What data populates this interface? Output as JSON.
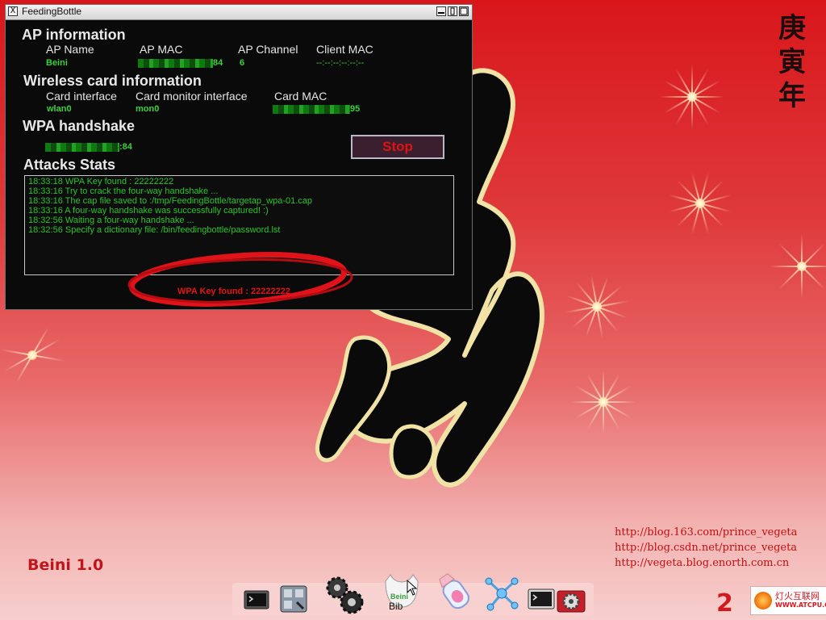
{
  "window": {
    "title": "FeedingBottle",
    "close_glyph": "X"
  },
  "ap_info": {
    "heading": "AP information",
    "columns": [
      "AP Name",
      "AP MAC",
      "AP Channel",
      "Client MAC"
    ],
    "ap_name": "Beini",
    "ap_mac_suffix": "84",
    "ap_channel": "6",
    "client_mac": "--:--:--:--:--:--"
  },
  "wireless_card": {
    "heading": "Wireless card information",
    "columns": [
      "Card interface",
      "Card monitor interface",
      "Card MAC"
    ],
    "card_interface": "wlan0",
    "monitor_interface": "mon0",
    "card_mac_suffix": "95"
  },
  "wpa_handshake": {
    "heading": "WPA handshake",
    "mac_suffix": ":84"
  },
  "stop_button": {
    "label": "Stop"
  },
  "attacks_stats": {
    "heading": "Attacks Stats",
    "lines": [
      "18:33:18 WPA Key found : 22222222",
      "18:33:16 Try to crack the four-way handshake ...",
      "18:33:16 The cap file saved to :/tmp/FeedingBottle/targetap_wpa-01.cap",
      "18:33:16 A four-way handshake was successfully captured! :)",
      "18:32:56 Waiting a four-way handshake ...",
      "18:32:56 Specify a dictionary file: /bin/feedingbottle/password.lst"
    ]
  },
  "status": {
    "wpa_key_found": "WPA Key found : 22222222"
  },
  "desktop": {
    "version_label": "Beini 1.0",
    "calligraphy": [
      "庚",
      "寅",
      "年"
    ],
    "blog_links": [
      "http://blog.163.com/prince_vegeta",
      "http://blog.csdn.net/prince_vegeta",
      "http://vegeta.blog.enorth.com.cn"
    ],
    "corner_logo": {
      "mark": "2",
      "name": "灯火互联网",
      "url": "WWW.ATCPU.COM"
    },
    "colors": {
      "background_top": "#d8161a",
      "background_bottom": "#f7cfcd",
      "accent_red": "#c0151b"
    }
  },
  "dock": {
    "items": [
      {
        "icon": "terminal-icon"
      },
      {
        "icon": "file-manager-icon"
      },
      {
        "icon": "gears-icon"
      },
      {
        "icon": "bib-icon",
        "label": "Bib"
      },
      {
        "icon": "feeding-bottle-icon"
      },
      {
        "icon": "network-icon"
      },
      {
        "icon": "console-icon"
      },
      {
        "icon": "settings-icon"
      }
    ]
  }
}
